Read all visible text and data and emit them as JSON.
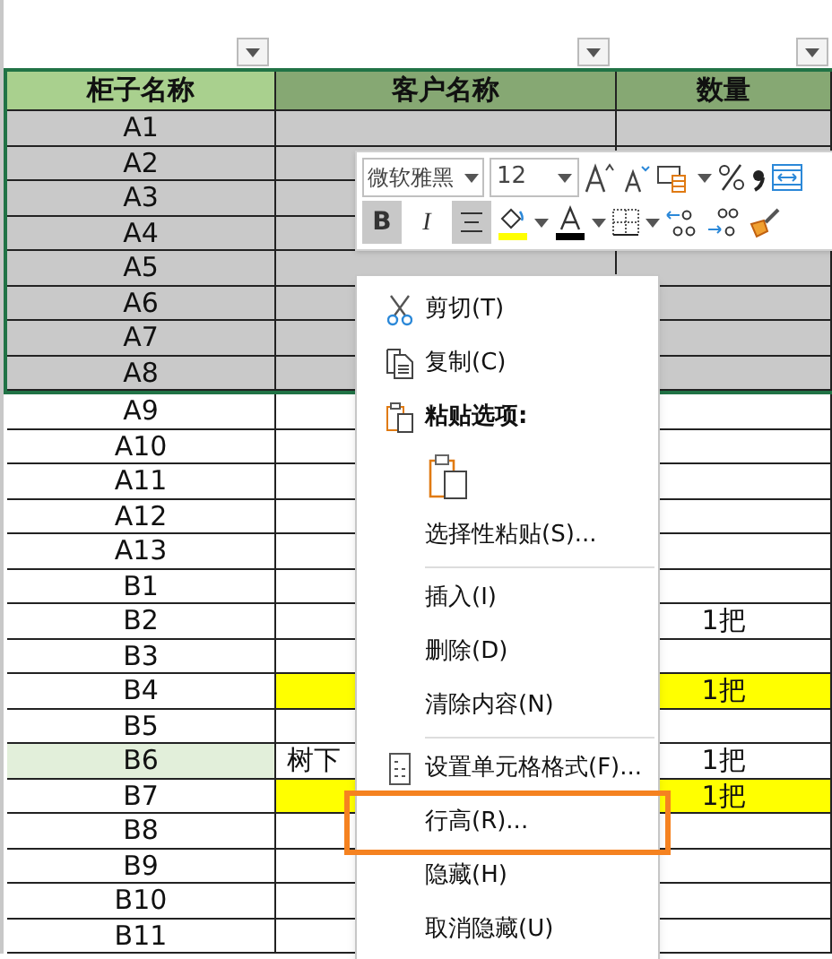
{
  "columns": [
    {
      "header": "柜子名称"
    },
    {
      "header": "客户名称"
    },
    {
      "header": "数量"
    }
  ],
  "rows": [
    {
      "name": {
        "text": "A1"
      },
      "selected": true
    },
    {
      "name": {
        "text": "A2"
      },
      "selected": true
    },
    {
      "name": {
        "text": "A3"
      },
      "selected": true
    },
    {
      "name": {
        "text": "A4"
      },
      "selected": true
    },
    {
      "name": {
        "text": "A5"
      },
      "selected": true
    },
    {
      "name": {
        "text": "A6"
      },
      "selected": true
    },
    {
      "name": {
        "text": "A7"
      },
      "selected": true
    },
    {
      "name": {
        "text": "A8"
      },
      "selected": true
    },
    {
      "name": {
        "text": "A9"
      },
      "selected": false
    },
    {
      "name": {
        "text": "A10"
      },
      "selected": false
    },
    {
      "name": {
        "text": "A11"
      },
      "selected": false
    },
    {
      "name": {
        "text": "A12"
      },
      "selected": false
    },
    {
      "name": {
        "text": "A13"
      },
      "selected": false
    },
    {
      "name": {
        "text": "B1"
      },
      "selected": false
    },
    {
      "name": {
        "text": "B2"
      },
      "quantity": {
        "text": "1把"
      },
      "selected": false
    },
    {
      "name": {
        "text": "B3"
      },
      "selected": false
    },
    {
      "name": {
        "text": "B4"
      },
      "customer": {
        "color": "#ffff00"
      },
      "quantity": {
        "text": "1把",
        "color": "#ffff00"
      },
      "selected": false
    },
    {
      "name": {
        "text": "B5"
      },
      "selected": false
    },
    {
      "name": {
        "text": "B6",
        "color": "#e2efda"
      },
      "customer": {
        "text": "树下"
      },
      "quantity": {
        "text": "1把"
      },
      "selected": false
    },
    {
      "name": {
        "text": "B7"
      },
      "customer": {
        "color": "#ffff00"
      },
      "quantity": {
        "text": "1把",
        "color": "#ffff00"
      },
      "selected": false
    },
    {
      "name": {
        "text": "B8"
      },
      "selected": false
    },
    {
      "name": {
        "text": "B9"
      },
      "selected": false
    },
    {
      "name": {
        "text": "B10"
      },
      "selected": false
    },
    {
      "name": {
        "text": "B11"
      },
      "selected": false
    }
  ],
  "mini_toolbar": {
    "font": "微软雅黑",
    "size": "12",
    "bold": {
      "label": "B",
      "selected": true
    },
    "italic": {
      "label": "I",
      "selected": false
    },
    "center": {
      "selected": true
    }
  },
  "context_menu": [
    {
      "kind": "cut",
      "label": "剪切(T)",
      "highlighted": false
    },
    {
      "kind": "copy",
      "label": "复制(C)",
      "highlighted": false
    },
    {
      "kind": "paste-header",
      "label": "粘贴选项:"
    },
    {
      "kind": "paste-option"
    },
    {
      "kind": "item",
      "label": "选择性粘贴(S)...",
      "highlighted": false
    },
    {
      "kind": "separator"
    },
    {
      "kind": "item",
      "label": "插入(I)",
      "highlighted": false
    },
    {
      "kind": "item",
      "label": "删除(D)",
      "highlighted": false
    },
    {
      "kind": "item",
      "label": "清除内容(N)",
      "highlighted": false
    },
    {
      "kind": "separator"
    },
    {
      "kind": "format",
      "label": "设置单元格格式(F)...",
      "highlighted": false
    },
    {
      "kind": "item",
      "label": "行高(R)...",
      "highlighted": true
    },
    {
      "kind": "item",
      "label": "隐藏(H)",
      "highlighted": false
    },
    {
      "kind": "item",
      "label": "取消隐藏(U)",
      "highlighted": false
    }
  ]
}
